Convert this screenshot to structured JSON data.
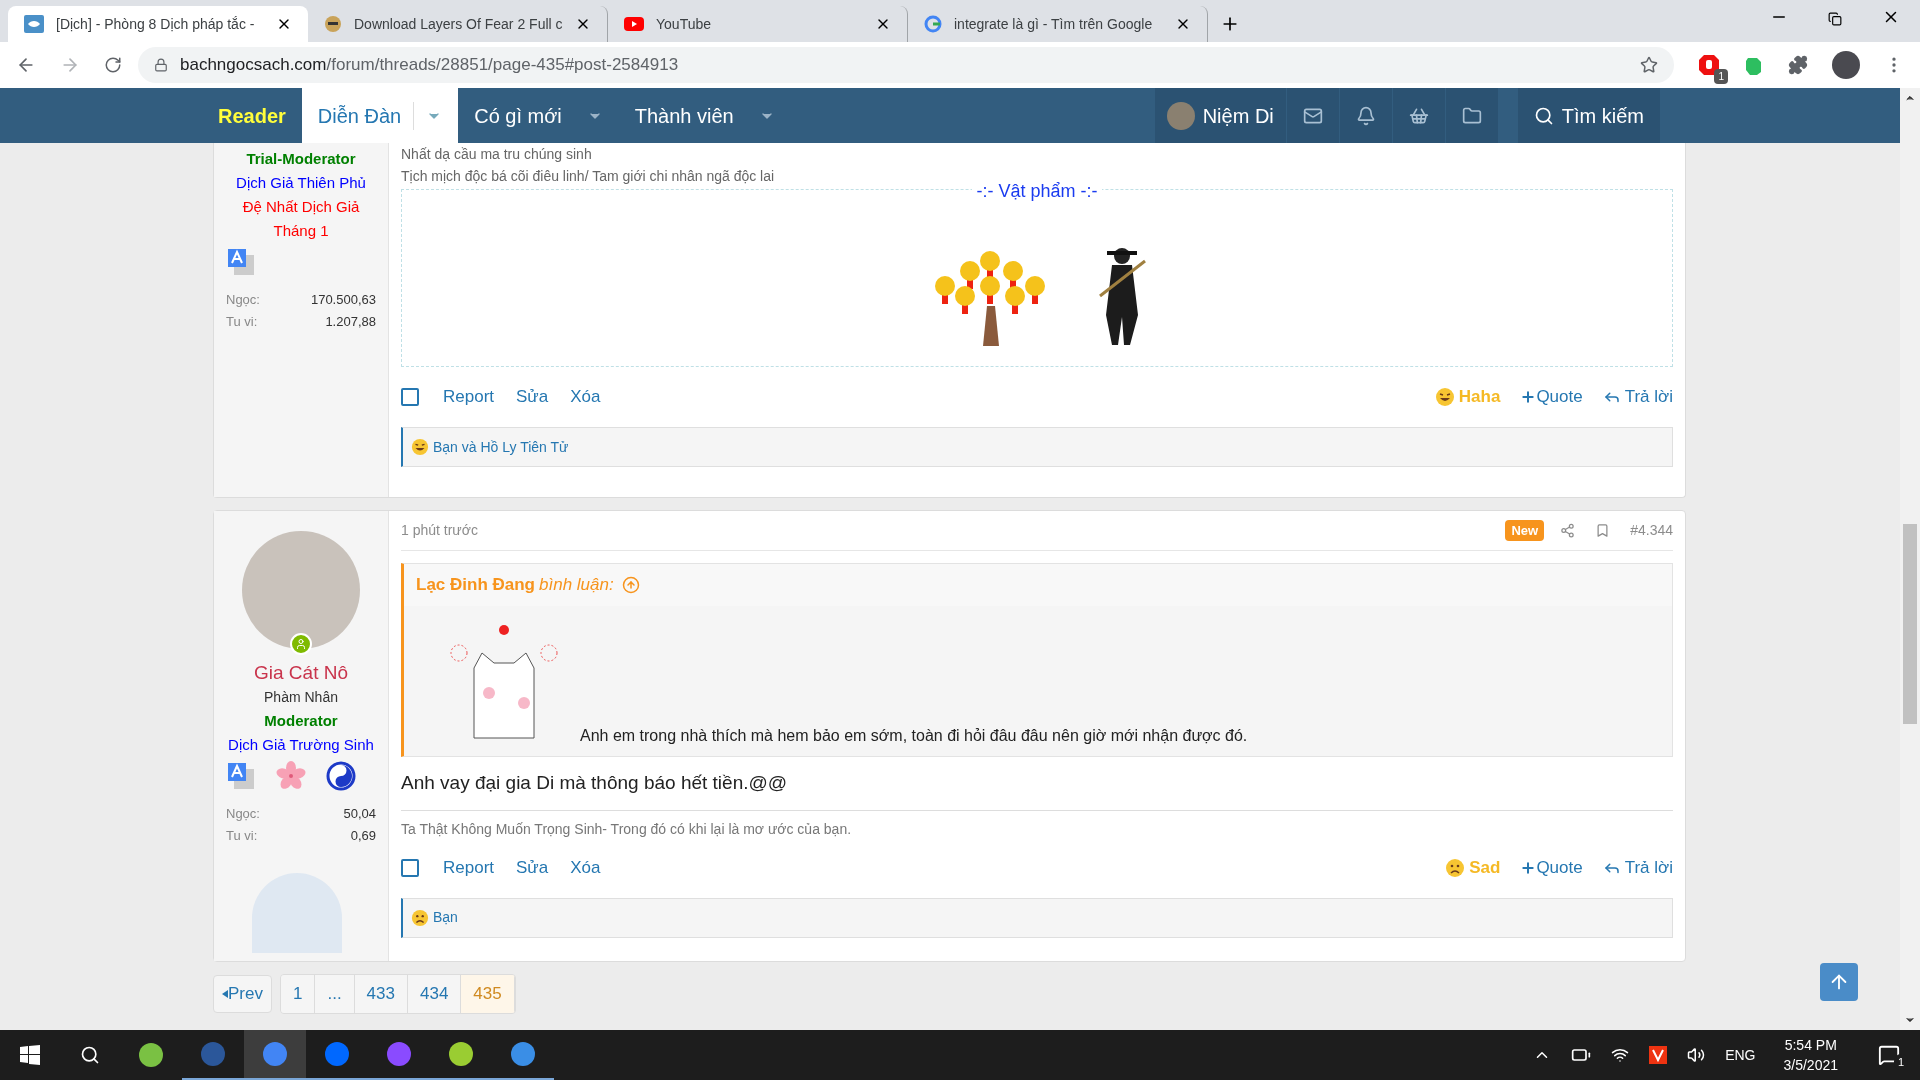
{
  "browser": {
    "tabs": [
      {
        "kind": "forum",
        "title": "[Dịch] - Phòng 8 Dịch pháp tắc -",
        "selected": true
      },
      {
        "kind": "game",
        "title": "Download Layers Of Fear 2 Full c",
        "selected": false
      },
      {
        "kind": "youtube",
        "title": "YouTube",
        "selected": false
      },
      {
        "kind": "google",
        "title": "integrate là gì - Tìm trên Google",
        "selected": false
      }
    ],
    "url_domain": "bachngocsach.com",
    "url_path": "/forum/threads/28851/page-435#post-2584913",
    "extension_badge": "1"
  },
  "nav": {
    "brand": "Reader",
    "items": [
      {
        "label": "Diễn Đàn",
        "selected": true
      },
      {
        "label": "Có gì mới",
        "selected": false
      },
      {
        "label": "Thành viên",
        "selected": false
      }
    ],
    "user": "Niệm Di",
    "search": "Tìm kiếm"
  },
  "posts": [
    {
      "user": {
        "ranks": [
          {
            "text": "Trial-Moderator",
            "color": "#008000"
          },
          {
            "text": "Dịch Giả Thiên Phủ",
            "color": "#0000ff"
          },
          {
            "text": "Đệ Nhất Dịch Giả Tháng 1",
            "color": "#ff0000"
          }
        ],
        "badges": [
          {
            "kind": "translate"
          }
        ],
        "stats": [
          {
            "label": "Ngọc:",
            "value": "170.500,63"
          },
          {
            "label": "Tu vi:",
            "value": "1.207,88"
          }
        ]
      },
      "signature_lines": [
        "Nhất dạ cầu ma tru chúng sinh",
        "Tịch mịch độc bá cõi điêu linh/ Tam giới chi nhân ngã độc lai"
      ],
      "items_title": "-:- Vật phẩm -:-",
      "actions": {
        "checked": false,
        "links": [
          "Report",
          "Sửa",
          "Xóa"
        ],
        "reaction": {
          "kind": "haha",
          "label": "Haha"
        },
        "quote": "Quote",
        "reply": "Trả lời"
      },
      "reactions_bar": {
        "kind": "haha",
        "text": "Bạn và Hồ Ly Tiên Tử"
      }
    },
    {
      "user": {
        "name": "Gia Cát Nô",
        "title": "Phàm Nhân",
        "ranks": [
          {
            "text": "Moderator",
            "color": "#008000"
          },
          {
            "text": "Dịch Giả Trường Sinh",
            "color": "#0000ff"
          }
        ],
        "badges": [
          {
            "kind": "translate"
          },
          {
            "kind": "sakura"
          },
          {
            "kind": "yinyang"
          }
        ],
        "stats": [
          {
            "label": "Ngọc:",
            "value": "50,04"
          },
          {
            "label": "Tu vi:",
            "value": "0,69"
          }
        ]
      },
      "time": "1 phút trước",
      "new_badge": "New",
      "number": "#4.344",
      "quote": {
        "author": "Lạc Đinh Đang",
        "verb": "bình luận:",
        "text": "Anh em trong nhà thích mà hem bảo em sớm, toàn đi hỏi đâu đâu nên giờ mới nhận được đó."
      },
      "body": "Anh vay đại gia Di mà thông báo hết tiền.@@",
      "signature_lines": [
        "Ta Thật Không Muốn Trọng Sinh- Trong đó có khi lại là mơ ước của bạn."
      ],
      "actions": {
        "checked": false,
        "links": [
          "Report",
          "Sửa",
          "Xóa"
        ],
        "reaction": {
          "kind": "sad",
          "label": "Sad"
        },
        "quote": "Quote",
        "reply": "Trả lời"
      },
      "reactions_bar": {
        "kind": "sad",
        "text": "Bạn"
      }
    }
  ],
  "pagination": {
    "prev": "Prev",
    "pages": [
      {
        "label": "1",
        "selected": false
      },
      {
        "label": "...",
        "selected": false
      },
      {
        "label": "433",
        "selected": false
      },
      {
        "label": "434",
        "selected": false
      },
      {
        "label": "435",
        "selected": true
      }
    ]
  },
  "taskbar": {
    "language": "ENG",
    "time": "5:54 PM",
    "date": "3/5/2021",
    "notifications": "1"
  }
}
